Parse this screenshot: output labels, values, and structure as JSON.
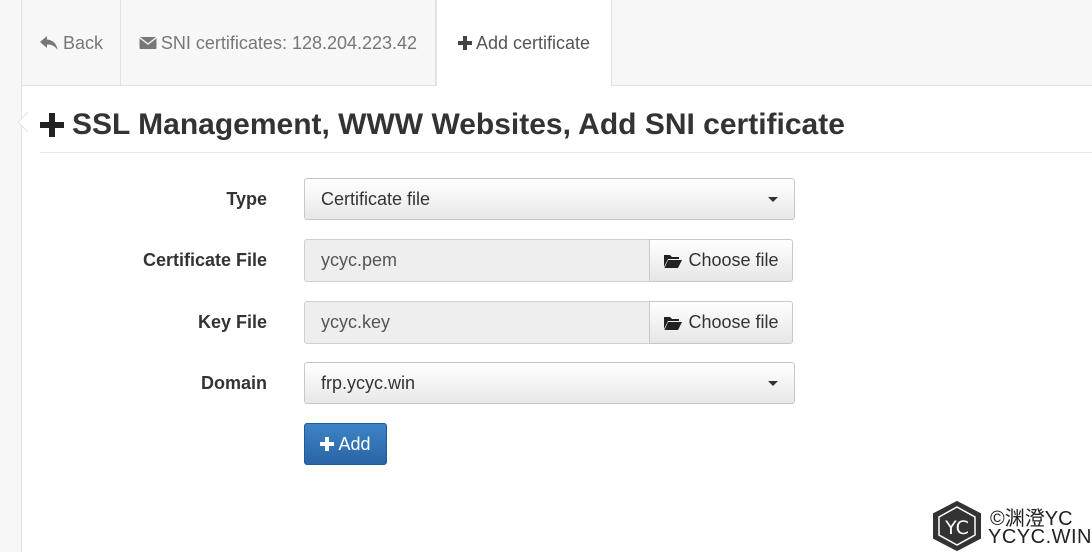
{
  "tabs": {
    "back": {
      "label": "Back",
      "icon": "reply-icon"
    },
    "sni": {
      "label": "SNI certificates: 128.204.223.42",
      "icon": "envelope-icon"
    },
    "add": {
      "label": "Add certificate",
      "icon": "plus-icon"
    }
  },
  "page": {
    "title": "SSL Management, WWW Websites, Add SNI certificate",
    "title_icon": "plus-icon"
  },
  "form": {
    "type": {
      "label": "Type",
      "value": "Certificate file"
    },
    "certificate_file": {
      "label": "Certificate File",
      "value": "ycyc.pem",
      "button": "Choose file"
    },
    "key_file": {
      "label": "Key File",
      "value": "ycyc.key",
      "button": "Choose file"
    },
    "domain": {
      "label": "Domain",
      "value": "frp.ycyc.win"
    },
    "submit": {
      "label": "Add"
    }
  },
  "watermark": {
    "logo_text": "YC",
    "line1": "©渊澄YC",
    "line2": "YCYC.WIN"
  },
  "colors": {
    "primary_button": "#2f6fb4",
    "background": "#f7f7f7",
    "panel": "#ffffff"
  }
}
